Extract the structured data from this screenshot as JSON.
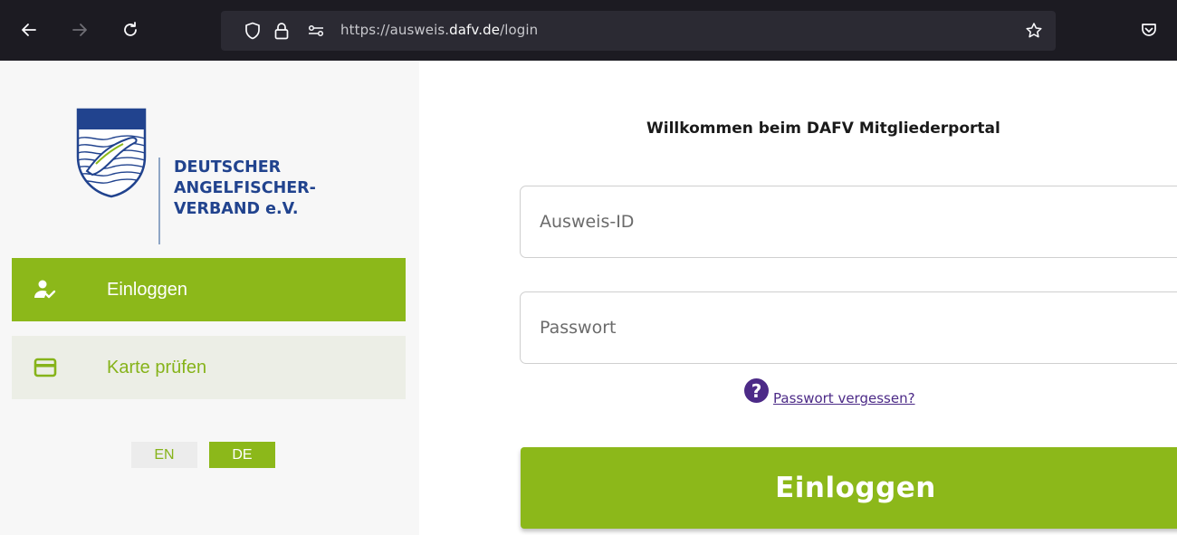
{
  "browser": {
    "url_prefix": "https://ausweis.",
    "url_domain": "dafv.de",
    "url_path": "/login"
  },
  "sidebar": {
    "logo_badge": "DAFV",
    "logo_text": {
      "line1": "DEUTSCHER",
      "line2": "ANGELFISCHER-",
      "line3": "VERBAND e.V."
    },
    "nav": [
      {
        "label": "Einloggen",
        "icon": "user-check-icon",
        "active": true
      },
      {
        "label": "Karte prüfen",
        "icon": "credit-card-icon",
        "active": false
      }
    ],
    "languages": [
      {
        "code": "EN",
        "active": false
      },
      {
        "code": "DE",
        "active": true
      }
    ]
  },
  "main": {
    "welcome": "Willkommen beim DAFV Mitgliederportal",
    "id_field": {
      "placeholder": "Ausweis-ID",
      "value": ""
    },
    "password_field": {
      "placeholder": "Passwort",
      "value": ""
    },
    "forgot_link": "Passwort vergessen?",
    "submit_label": "Einloggen"
  },
  "colors": {
    "brand_green": "#8cb81a",
    "brand_blue": "#21438e",
    "link_purple": "#4c2a87",
    "chrome_dark": "#1c1b22"
  }
}
